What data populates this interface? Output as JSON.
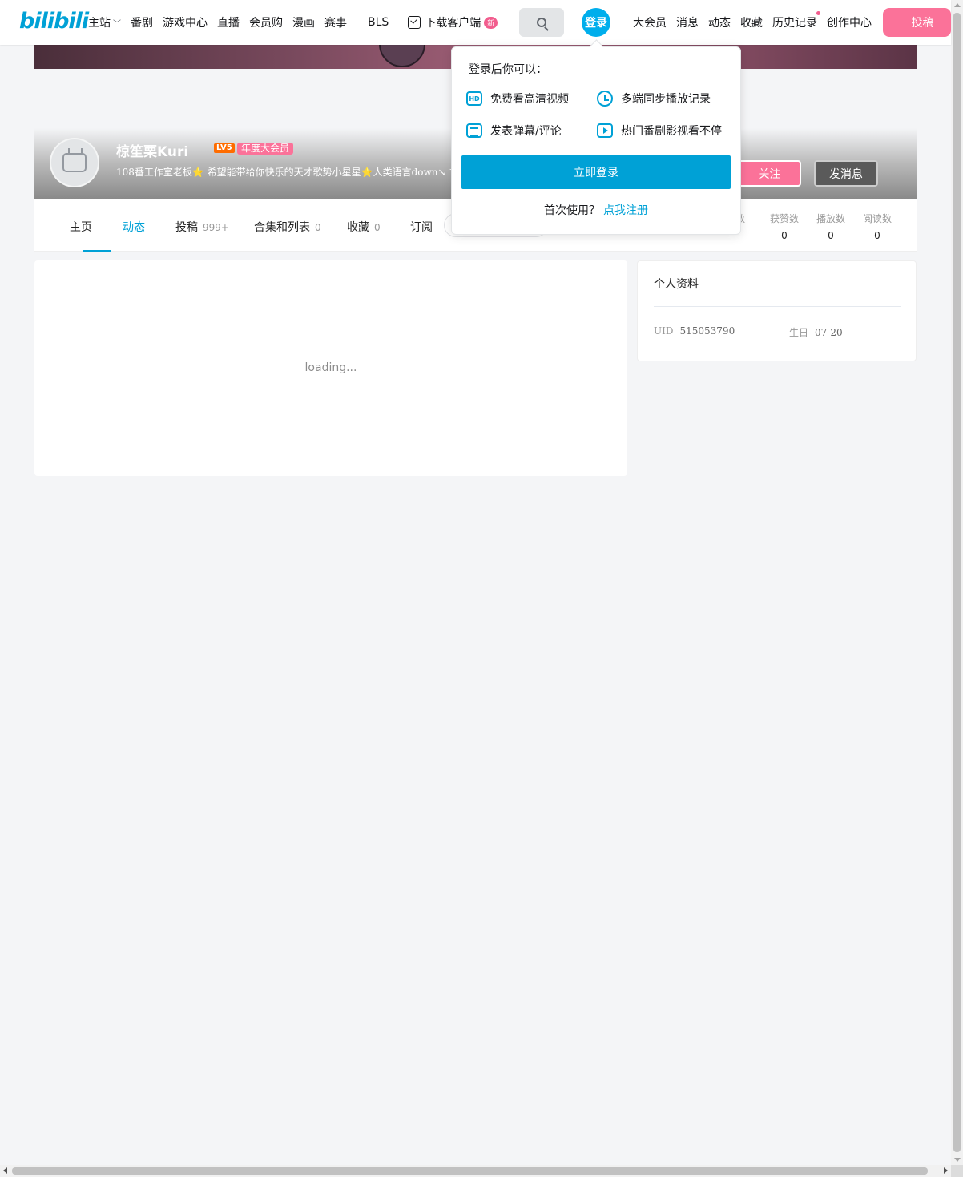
{
  "header": {
    "logo_text": "bilibili",
    "nav_left": [
      "主站",
      "番剧",
      "游戏中心",
      "直播",
      "会员购",
      "漫画",
      "赛事",
      "BLS"
    ],
    "download_label": "下载客户端",
    "download_badge": "新",
    "login_label": "登录",
    "nav_right": [
      "大会员",
      "消息",
      "动态",
      "收藏",
      "历史记录",
      "创作中心"
    ],
    "upload_label": "投稿"
  },
  "profile": {
    "username": "椋笙栗Kuri",
    "level": "LV5",
    "vip_label": "年度大会员",
    "sign": "108番工作室老板⭐ 希望能带给你快乐的天才歌势小星星⭐人类语言down↘ マ",
    "follow_label": "关注",
    "message_label": "发消息"
  },
  "tabs": {
    "items": [
      {
        "label": "主页",
        "count": ""
      },
      {
        "label": "动态",
        "count": ""
      },
      {
        "label": "投稿",
        "count": "999+"
      },
      {
        "label": "合集和列表",
        "count": "0"
      },
      {
        "label": "收藏",
        "count": "0"
      },
      {
        "label": "订阅",
        "count": ""
      }
    ],
    "stats": [
      {
        "label": "获赞数",
        "value": "0"
      },
      {
        "label": "播放数",
        "value": "0"
      },
      {
        "label": "阅读数",
        "value": "0"
      }
    ],
    "partial_stat_label": "数"
  },
  "main": {
    "loading_text": "loading..."
  },
  "side": {
    "title": "个人资料",
    "uid_label": "UID",
    "uid_value": "515053790",
    "birthday_label": "生日",
    "birthday_value": "07-20"
  },
  "popover": {
    "title": "登录后你可以：",
    "perks": [
      "免费看高清视频",
      "多端同步播放记录",
      "发表弹幕/评论",
      "热门番剧影视看不停"
    ],
    "hd_icon_text": "HD",
    "login_button": "立即登录",
    "footer_text": "首次使用？",
    "register_link": "点我注册"
  },
  "colors": {
    "brand_blue": "#00a1d6",
    "pink": "#fb7299"
  }
}
